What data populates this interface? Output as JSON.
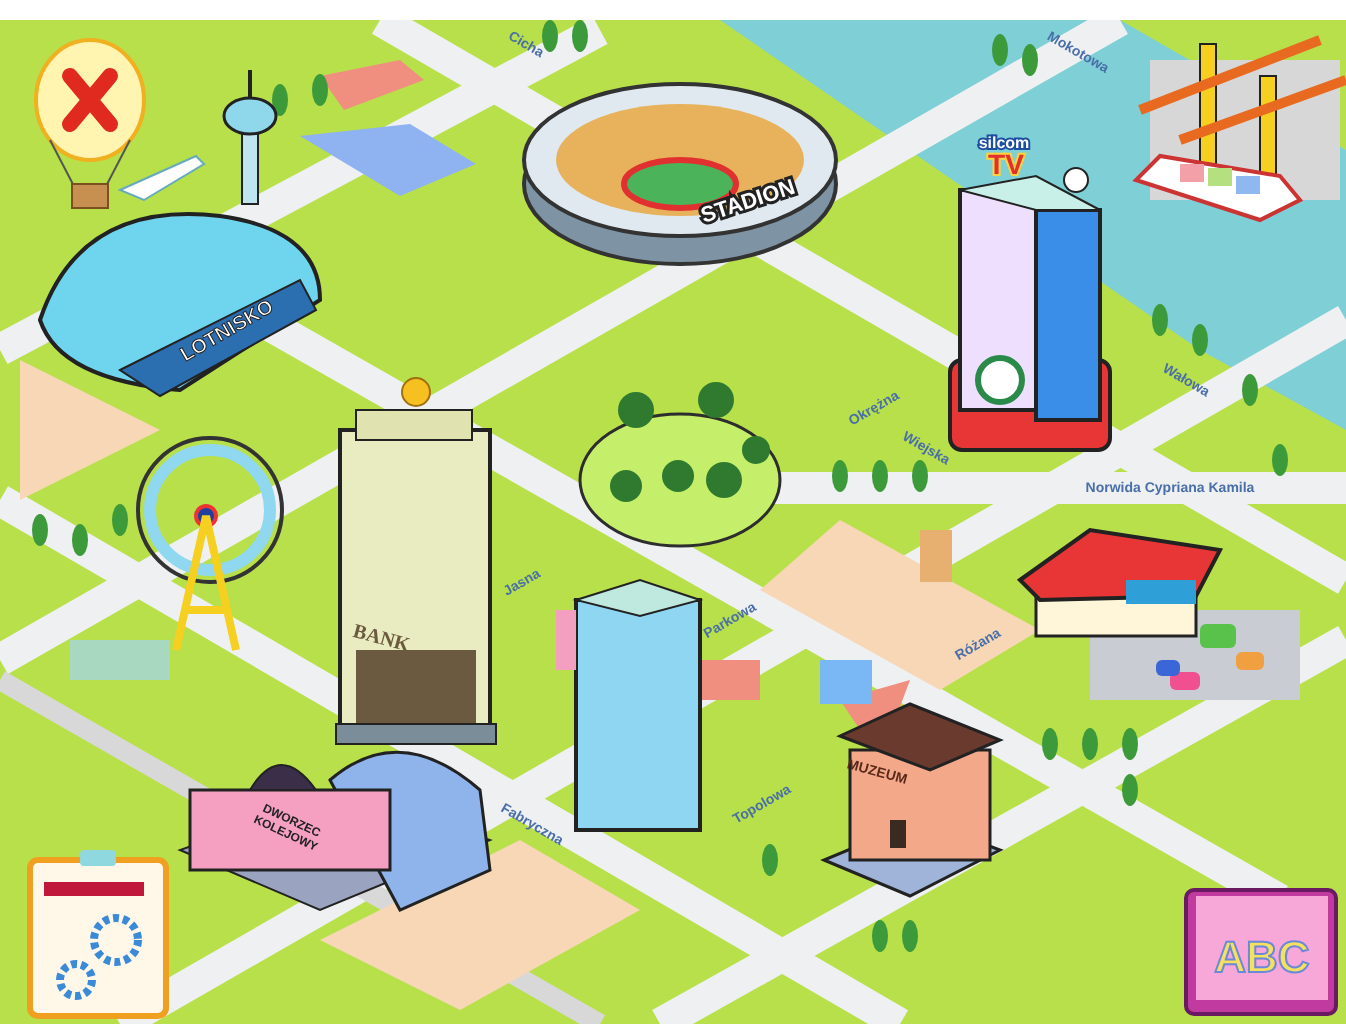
{
  "map": {
    "buildings": [
      {
        "kind": "stadium",
        "label": "STADION"
      },
      {
        "kind": "airport",
        "label": "LOTNISKO"
      },
      {
        "kind": "control-tower"
      },
      {
        "kind": "tv-tower",
        "label": "silcom",
        "sublabel": "TV"
      },
      {
        "kind": "port"
      },
      {
        "kind": "park"
      },
      {
        "kind": "ferris-wheel"
      },
      {
        "kind": "bank",
        "label": "BANK"
      },
      {
        "kind": "office"
      },
      {
        "kind": "supermarket"
      },
      {
        "kind": "station",
        "label": "DWORZEC KOLEJOWY"
      },
      {
        "kind": "museum",
        "label": "MUZEUM"
      }
    ],
    "streets": [
      {
        "name": "Cicha"
      },
      {
        "name": "Mokotowa"
      },
      {
        "name": "Okrężna"
      },
      {
        "name": "Wiejska"
      },
      {
        "name": "Wałowa"
      },
      {
        "name": "Norwida Cypriana Kamila"
      },
      {
        "name": "Jasna"
      },
      {
        "name": "Parkowa"
      },
      {
        "name": "Różana"
      },
      {
        "name": "Topolowa"
      },
      {
        "name": "Fabryczna"
      }
    ]
  },
  "buttons": [
    {
      "kind": "close"
    },
    {
      "kind": "settings"
    },
    {
      "kind": "alphabet",
      "label": "ABC"
    }
  ]
}
